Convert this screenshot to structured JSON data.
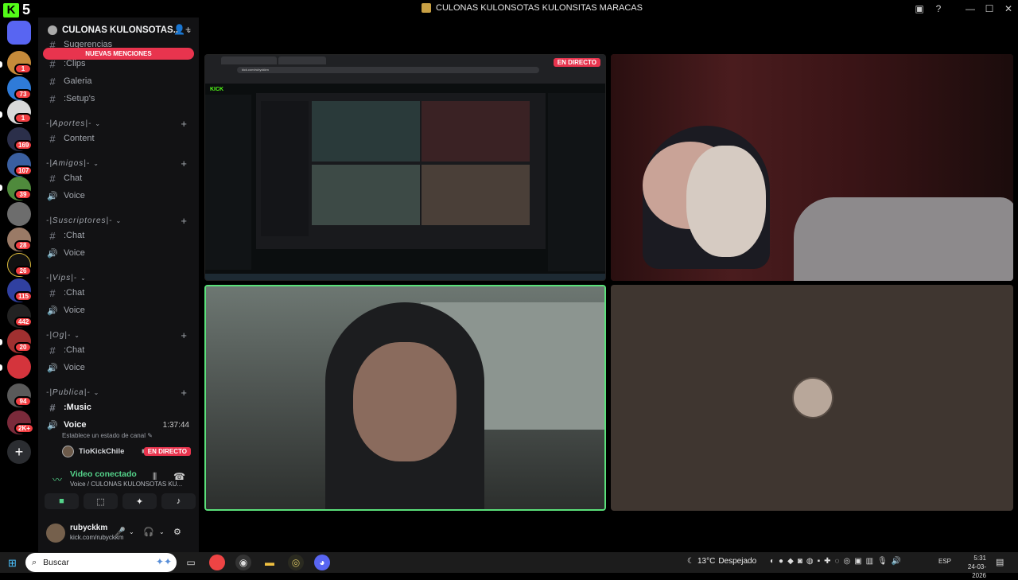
{
  "window": {
    "app_badge": "5",
    "title": "CULONAS KULONSOTAS KULONSITAS MARACAS"
  },
  "rail": {
    "badges": [
      "1",
      "73",
      "1",
      "169",
      "107",
      "39",
      "28",
      "26",
      "115",
      "442",
      "20",
      "94",
      "2K+"
    ]
  },
  "server": {
    "name": "CULONAS KULONSOTAS...",
    "new_mentions": "NUEVAS MENCIONES"
  },
  "channels": {
    "sugerencias": "Sugerencias",
    "clips": ":Clips",
    "galeria": "Galeria",
    "setups": ":Setup's",
    "cat_aportes": "-|Aportes|-",
    "content": "Content",
    "cat_amigos": "-|Amigos|-",
    "amigos_chat": "Chat",
    "amigos_voice": "Voice",
    "cat_suscriptores": "-|Suscriptores|-",
    "sus_chat": ":Chat",
    "sus_voice": "Voice",
    "cat_vips": "-|Vips|-",
    "vips_chat": ":Chat",
    "vips_voice": "Voice",
    "cat_og": "-|Og|-",
    "og_chat": ":Chat",
    "og_voice": "Voice",
    "cat_publica": "-|Publica|-",
    "music": ":Music",
    "pub_voice": "Voice",
    "timer": "1:37:44",
    "status_prompt": "Establece un estado de canal",
    "live_user": "TioKickChile",
    "live_label": "EN DIRECTO"
  },
  "voice_panel": {
    "title": "Video conectado",
    "subtitle": "Voice / CULONAS KULONSOTAS KU..."
  },
  "user": {
    "name": "rubyckkm",
    "status": "kick.com/rubyckkm"
  },
  "stream": {
    "live_label": "EN DIRECTO",
    "url": "kick.com/rubyckkm",
    "site": "KICK"
  },
  "taskbar": {
    "search": "Buscar",
    "weather_temp": "13°C",
    "weather_desc": "Despejado",
    "lang": "ESP",
    "time": "5:31",
    "date": "24-03-2026"
  }
}
